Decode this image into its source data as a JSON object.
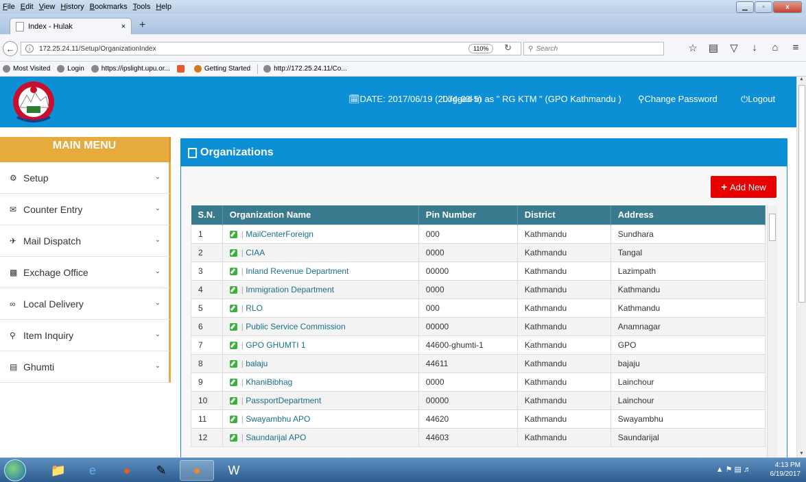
{
  "browser": {
    "menu": [
      "File",
      "Edit",
      "View",
      "History",
      "Bookmarks",
      "Tools",
      "Help"
    ],
    "tab_title": "Index - Hulak",
    "tab_close": "×",
    "new_tab": "+",
    "url": "172.25.24.11/Setup/OrganizationIndex",
    "zoom": "110%",
    "search_placeholder": "Search",
    "bookmarks": [
      "Most Visited",
      "Login",
      "https://ipslight.upu.or...",
      "Getting Started",
      "http://172.25.24.11/Co..."
    ]
  },
  "header": {
    "date": "DATE: 2017/06/19 (2074-03-5)",
    "logged_in": "Logged In as \" RG KTM \" (GPO Kathmandu )",
    "change_password": "Change Password",
    "logout": "Logout"
  },
  "sidebar": {
    "title": "MAIN MENU",
    "items": [
      {
        "label": "Setup",
        "icon": "gears-icon"
      },
      {
        "label": "Counter Entry",
        "icon": "envelope-icon"
      },
      {
        "label": "Mail Dispatch",
        "icon": "plane-icon"
      },
      {
        "label": "Exchage Office",
        "icon": "briefcase-icon"
      },
      {
        "label": "Local Delivery",
        "icon": "bicycle-icon"
      },
      {
        "label": "Item Inquiry",
        "icon": "search-icon"
      },
      {
        "label": "Ghumti",
        "icon": "bus-icon"
      }
    ]
  },
  "panel": {
    "title": "Organizations",
    "add_new": "Add New"
  },
  "table": {
    "headers": [
      "S.N.",
      "Organization Name",
      "Pin Number",
      "District",
      "Address"
    ],
    "rows": [
      [
        "1",
        "MailCenterForeign",
        "000",
        "Kathmandu",
        "Sundhara"
      ],
      [
        "2",
        "CIAA",
        "0000",
        "Kathmandu",
        "Tangal"
      ],
      [
        "3",
        "Inland Revenue Department",
        "00000",
        "Kathmandu",
        "Lazimpath"
      ],
      [
        "4",
        "Immigration Department",
        "0000",
        "Kathmandu",
        "Kathmandu"
      ],
      [
        "5",
        "RLO",
        "000",
        "Kathmandu",
        "Kathmandu"
      ],
      [
        "6",
        "Public Service Commission",
        "00000",
        "Kathmandu",
        "Anamnagar"
      ],
      [
        "7",
        "GPO GHUMTI 1",
        "44600-ghumti-1",
        "Kathmandu",
        "GPO"
      ],
      [
        "8",
        "balaju",
        "44611",
        "Kathmandu",
        "bajaju"
      ],
      [
        "9",
        "KhaniBibhag",
        "0000",
        "Kathmandu",
        "Lainchour"
      ],
      [
        "10",
        "PassportDepartment",
        "00000",
        "Kathmandu",
        "Lainchour"
      ],
      [
        "11",
        "Swayambhu APO",
        "44620",
        "Kathmandu",
        "Swayambhu"
      ],
      [
        "12",
        "Saundarijal APO",
        "44603",
        "Kathmandu",
        "Saundarijal"
      ]
    ]
  },
  "taskbar": {
    "time": "4:13 PM",
    "date": "6/19/2017"
  }
}
